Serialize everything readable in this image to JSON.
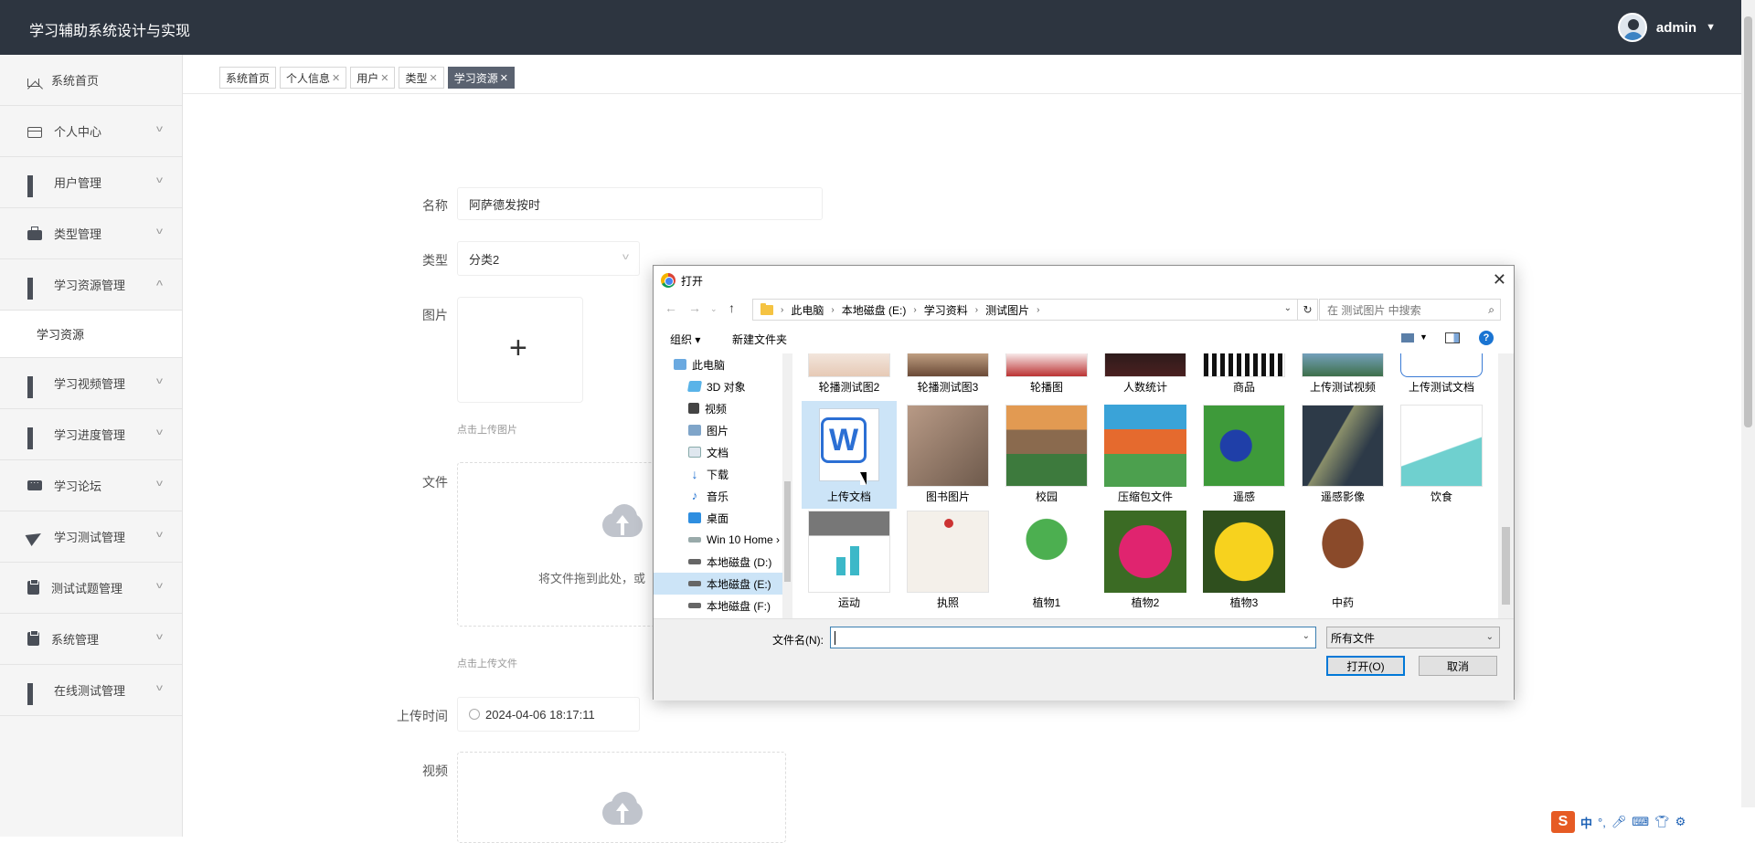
{
  "app": {
    "title": "学习辅助系统设计与实现",
    "user": "admin"
  },
  "sidebar": {
    "items": [
      {
        "label": "系统首页"
      },
      {
        "label": "个人中心"
      },
      {
        "label": "用户管理"
      },
      {
        "label": "类型管理"
      },
      {
        "label": "学习资源管理"
      },
      {
        "label": "学习视频管理"
      },
      {
        "label": "学习进度管理"
      },
      {
        "label": "学习论坛"
      },
      {
        "label": "学习测试管理"
      },
      {
        "label": "测试试题管理"
      },
      {
        "label": "系统管理"
      },
      {
        "label": "在线测试管理"
      }
    ],
    "sub_item": "学习资源"
  },
  "tabs": [
    {
      "label": "系统首页",
      "closable": false
    },
    {
      "label": "个人信息",
      "closable": true
    },
    {
      "label": "用户",
      "closable": true
    },
    {
      "label": "类型",
      "closable": true
    },
    {
      "label": "学习资源",
      "closable": true,
      "active": true
    }
  ],
  "form": {
    "name_label": "名称",
    "name_value": "阿萨德发按时",
    "type_label": "类型",
    "type_value": "分类2",
    "image_label": "图片",
    "image_hint": "点击上传图片",
    "file_label": "文件",
    "file_drop_text": "将文件拖到此处，或",
    "file_hint": "点击上传文件",
    "time_label": "上传时间",
    "time_value": "2024-04-06 18:17:11",
    "video_label": "视频"
  },
  "dialog": {
    "title": "打开",
    "path": [
      "此电脑",
      "本地磁盘 (E:)",
      "学习资料",
      "测试图片"
    ],
    "search_placeholder": "在 测试图片 中搜索",
    "organize": "组织",
    "new_folder": "新建文件夹",
    "tree": [
      {
        "label": "此电脑",
        "icon": "pc-icon"
      },
      {
        "label": "3D 对象",
        "icon": "3d-icon"
      },
      {
        "label": "视频",
        "icon": "video-icon"
      },
      {
        "label": "图片",
        "icon": "picture-icon"
      },
      {
        "label": "文档",
        "icon": "document-icon"
      },
      {
        "label": "下载",
        "icon": "download-icon"
      },
      {
        "label": "音乐",
        "icon": "music-icon"
      },
      {
        "label": "桌面",
        "icon": "desktop-icon"
      },
      {
        "label": "Win 10 Home ›",
        "icon": "drive-icon"
      },
      {
        "label": "本地磁盘 (D:)",
        "icon": "drive-icon"
      },
      {
        "label": "本地磁盘 (E:)",
        "icon": "drive-icon",
        "selected": true
      },
      {
        "label": "本地磁盘 (F:)",
        "icon": "drive-icon"
      }
    ],
    "files": [
      {
        "name": "轮播测试图2"
      },
      {
        "name": "轮播测试图3"
      },
      {
        "name": "轮播图"
      },
      {
        "name": "人数统计"
      },
      {
        "name": "商品"
      },
      {
        "name": "上传测试视频"
      },
      {
        "name": "上传测试文档"
      },
      {
        "name": "上传文档",
        "selected": true
      },
      {
        "name": "图书图片"
      },
      {
        "name": "校园"
      },
      {
        "name": "压缩包文件"
      },
      {
        "name": "遥感"
      },
      {
        "name": "遥感影像"
      },
      {
        "name": "饮食"
      },
      {
        "name": "运动"
      },
      {
        "name": "执照"
      },
      {
        "name": "植物1"
      },
      {
        "name": "植物2"
      },
      {
        "name": "植物3"
      },
      {
        "name": "中药"
      }
    ],
    "filename_label": "文件名(N):",
    "filename_value": "",
    "filter": "所有文件",
    "open": "打开(O)",
    "cancel": "取消"
  },
  "tray": {
    "ime": "中"
  }
}
